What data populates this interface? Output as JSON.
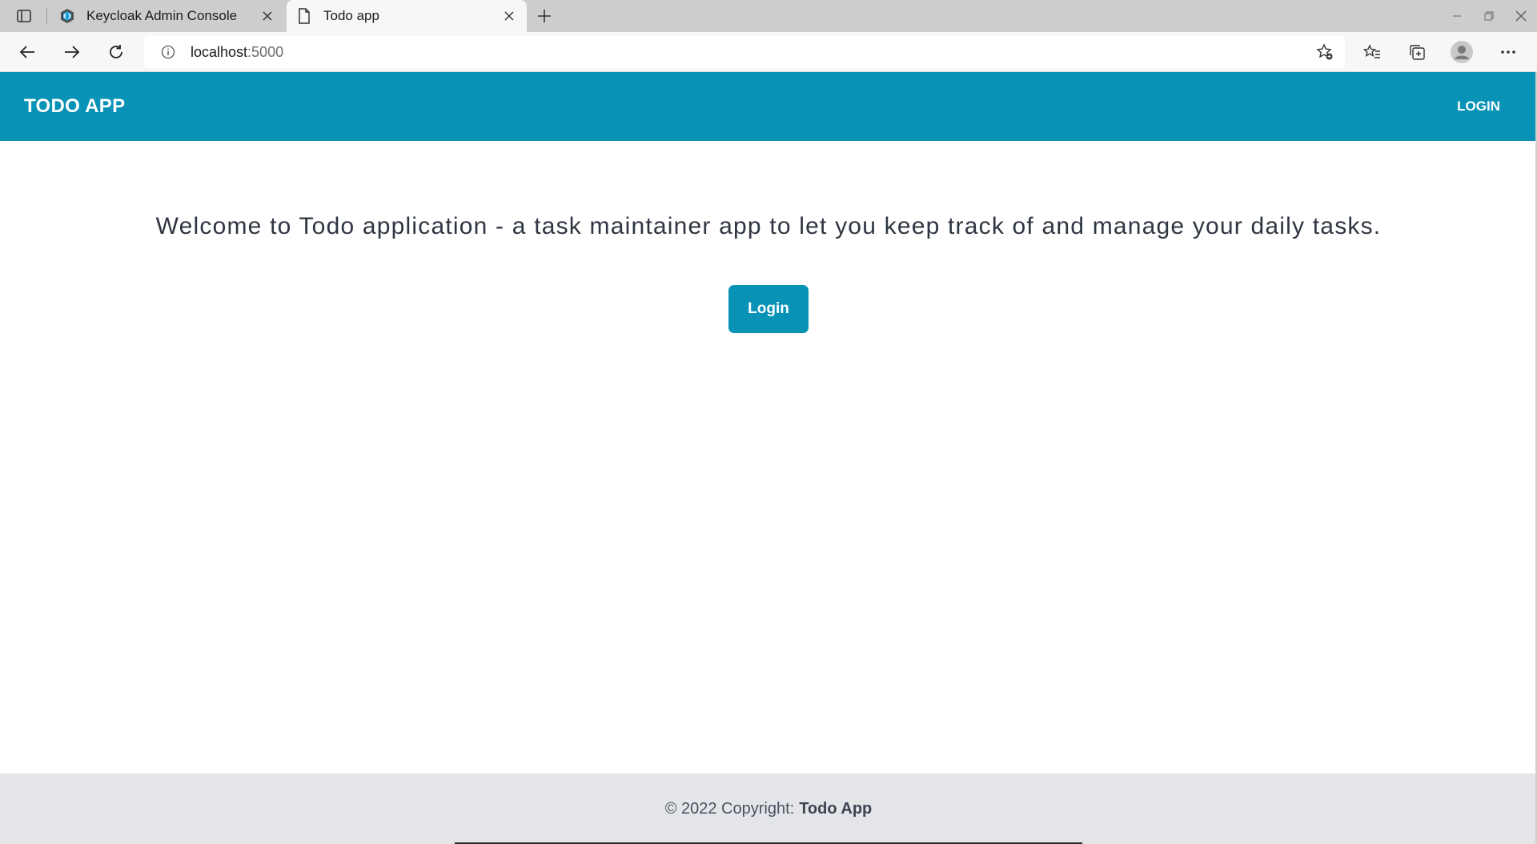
{
  "browser": {
    "tabs": [
      {
        "title": "Keycloak Admin Console",
        "active": false,
        "favicon": "keycloak-icon"
      },
      {
        "title": "Todo app",
        "active": true,
        "favicon": "page-icon"
      }
    ],
    "address": {
      "host": "localhost",
      "port": ":5000"
    }
  },
  "navbar": {
    "brand": "TODO APP",
    "login_label": "LOGIN"
  },
  "main": {
    "welcome_text": "Welcome to Todo application - a task maintainer app to let you keep track of and manage your daily tasks.",
    "login_button_label": "Login"
  },
  "footer": {
    "copyright_text": "© 2022 Copyright:",
    "brand": "Todo App"
  },
  "colors": {
    "accent": "#0892b6",
    "footer_bg": "#e4e5e8",
    "text_dark": "#2f3641"
  }
}
